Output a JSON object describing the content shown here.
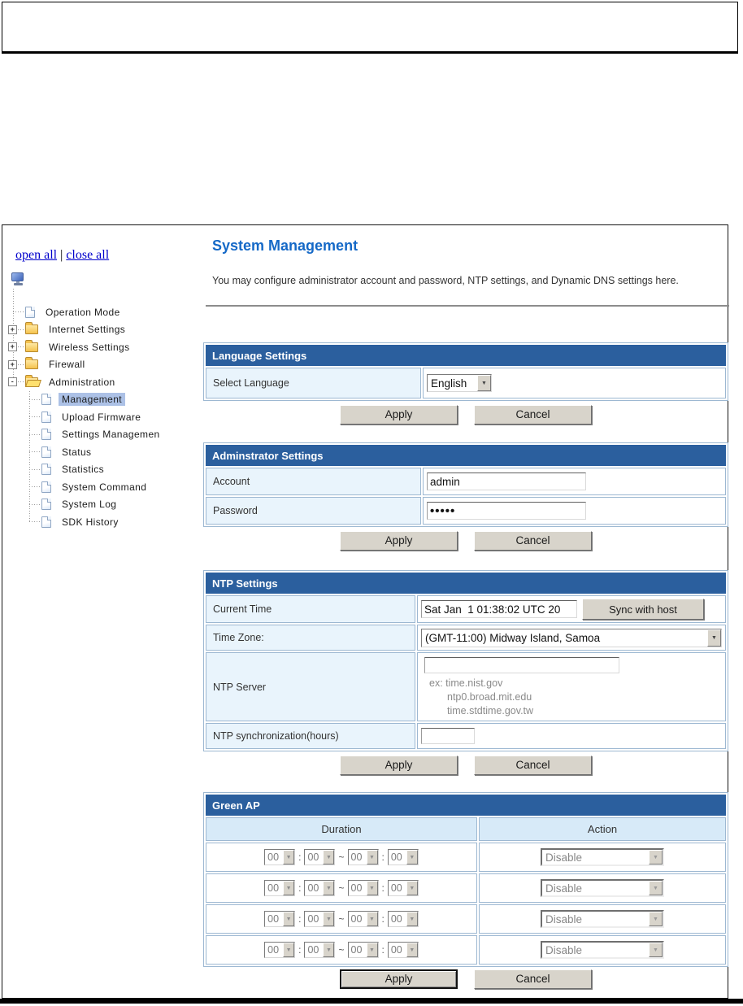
{
  "sidebar": {
    "open_all_link": "open all",
    "link_separator": "|",
    "close_all_link": "close all",
    "tree": [
      {
        "label": "Operation Mode",
        "icon": "page",
        "expander": "",
        "selected": false
      },
      {
        "label": "Internet Settings",
        "icon": "folder",
        "expander": "+",
        "selected": false
      },
      {
        "label": "Wireless Settings",
        "icon": "folder",
        "expander": "+",
        "selected": false
      },
      {
        "label": "Firewall",
        "icon": "folder",
        "expander": "+",
        "selected": false
      },
      {
        "label": "Administration",
        "icon": "folder-open",
        "expander": "-",
        "selected": false
      },
      {
        "label": "Management",
        "icon": "page",
        "expander": "",
        "selected": true
      },
      {
        "label": "Upload Firmware",
        "icon": "page",
        "expander": "",
        "selected": false
      },
      {
        "label": "Settings Managemen",
        "icon": "page",
        "expander": "",
        "selected": false
      },
      {
        "label": "Status",
        "icon": "page",
        "expander": "",
        "selected": false
      },
      {
        "label": "Statistics",
        "icon": "page",
        "expander": "",
        "selected": false
      },
      {
        "label": "System Command",
        "icon": "page",
        "expander": "",
        "selected": false
      },
      {
        "label": "System Log",
        "icon": "page",
        "expander": "",
        "selected": false
      },
      {
        "label": "SDK History",
        "icon": "page",
        "expander": "",
        "selected": false
      }
    ]
  },
  "main": {
    "title": "System Management",
    "description": "You may configure administrator account and password, NTP settings, and Dynamic DNS settings here.",
    "buttons": {
      "apply": "Apply",
      "cancel": "Cancel"
    },
    "language": {
      "header": "Language Settings",
      "select_language_label": "Select Language",
      "selected_language": "English"
    },
    "admin": {
      "header": "Adminstrator Settings",
      "account_label": "Account",
      "account_value": "admin",
      "password_label": "Password",
      "password_value": "•••••"
    },
    "ntp": {
      "header": "NTP Settings",
      "current_time_label": "Current Time",
      "current_time_value": "Sat Jan  1 01:38:02 UTC 20",
      "sync_button": "Sync with host",
      "time_zone_label": "Time Zone:",
      "time_zone_value": "(GMT-11:00) Midway Island, Samoa",
      "ntp_server_label": "NTP Server",
      "ntp_server_value": "",
      "ntp_server_examples": [
        "ex: time.nist.gov",
        "ntp0.broad.mit.edu",
        "time.stdtime.gov.tw"
      ],
      "sync_hours_label": "NTP synchronization(hours)",
      "sync_hours_value": ""
    },
    "green_ap": {
      "header": "Green AP",
      "duration_header": "Duration",
      "action_header": "Action",
      "time_separator": ":",
      "range_separator": "~",
      "rows": [
        {
          "times": [
            "00",
            "00",
            "00",
            "00"
          ],
          "action": "Disable"
        },
        {
          "times": [
            "00",
            "00",
            "00",
            "00"
          ],
          "action": "Disable"
        },
        {
          "times": [
            "00",
            "00",
            "00",
            "00"
          ],
          "action": "Disable"
        },
        {
          "times": [
            "00",
            "00",
            "00",
            "00"
          ],
          "action": "Disable"
        }
      ]
    }
  },
  "colors": {
    "section_header_bg": "#2B5F9E",
    "label_cell_bg": "#E9F4FC",
    "subheader_bg": "#D7EAF8",
    "title_blue": "#1569C7",
    "link_blue": "#0000CC",
    "selected_tree_bg": "#ACC1E6"
  }
}
